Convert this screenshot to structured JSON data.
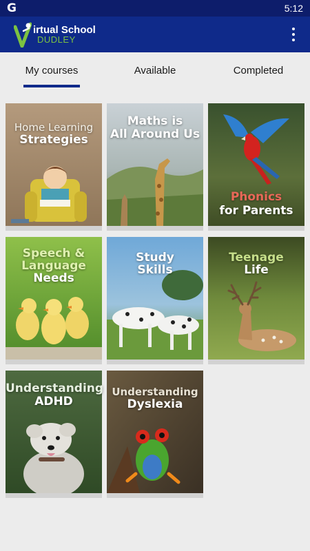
{
  "status_bar": {
    "left_icon": "G",
    "time": "5:12"
  },
  "app_bar": {
    "logo_line1": "irtual School",
    "logo_line2": "DUDLEY",
    "logo_mark": "V",
    "menu_icon": "more-vert-icon"
  },
  "tabs": [
    {
      "label": "My courses",
      "active": true
    },
    {
      "label": "Available",
      "active": false
    },
    {
      "label": "Completed",
      "active": false
    }
  ],
  "courses": [
    {
      "line1": "Home Learning",
      "line2": "Strategies"
    },
    {
      "line1": "Maths is",
      "line2": "All Around Us"
    },
    {
      "line1": "Phonics",
      "line2": "for Parents"
    },
    {
      "line1": "Speech &",
      "line2": "Language",
      "line3": "Needs"
    },
    {
      "line1": "Study",
      "line2": "Skills"
    },
    {
      "line1": "Teenage",
      "line2": "Life"
    },
    {
      "line1": "Understanding",
      "line2": "ADHD"
    },
    {
      "line1": "Understanding",
      "line2": "Dyslexia"
    }
  ],
  "colors": {
    "status_bar": "#0d1d6b",
    "app_bar": "#0f2a8a",
    "accent_green": "#7cc242",
    "tab_indicator": "#0f2a8a",
    "background": "#ececec"
  }
}
